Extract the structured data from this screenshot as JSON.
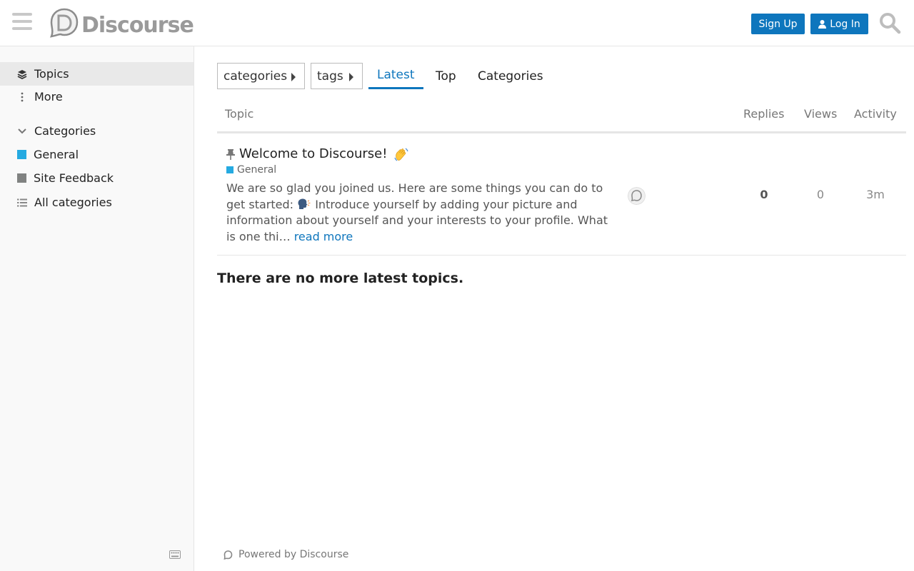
{
  "header": {
    "logo_text": "Discourse",
    "signup_label": "Sign Up",
    "login_label": "Log In"
  },
  "sidebar": {
    "items": [
      {
        "label": "Topics",
        "icon": "layers-icon",
        "active": true
      },
      {
        "label": "More",
        "icon": "vertical-ellipsis-icon",
        "active": false
      }
    ],
    "categories_heading": "Categories",
    "categories": [
      {
        "label": "General",
        "color": "#25aae1"
      },
      {
        "label": "Site Feedback",
        "color": "#808281"
      },
      {
        "label": "All categories",
        "icon": "list-icon"
      }
    ]
  },
  "nav": {
    "categories_dropdown": "categories",
    "tags_dropdown": "tags",
    "tabs": [
      {
        "label": "Latest",
        "active": true
      },
      {
        "label": "Top",
        "active": false
      },
      {
        "label": "Categories",
        "active": false
      }
    ]
  },
  "table": {
    "headers": {
      "topic": "Topic",
      "replies": "Replies",
      "views": "Views",
      "activity": "Activity"
    },
    "rows": [
      {
        "title": "Welcome to Discourse!",
        "pinned": true,
        "category": "General",
        "category_color": "#25aae1",
        "excerpt_part1": "We are so glad you joined us. Here are some things you can do to get started:",
        "excerpt_part2": "Introduce yourself by adding your picture and information about yourself and your interests to your profile. What is one thi…",
        "read_more": "read more",
        "replies": "0",
        "views": "0",
        "activity": "3m"
      }
    ]
  },
  "footer_message": "There are no more latest topics.",
  "powered_by": "Powered by Discourse",
  "colors": {
    "accent": "#0e76bd",
    "sidebar_bg": "#f9f9f9"
  }
}
